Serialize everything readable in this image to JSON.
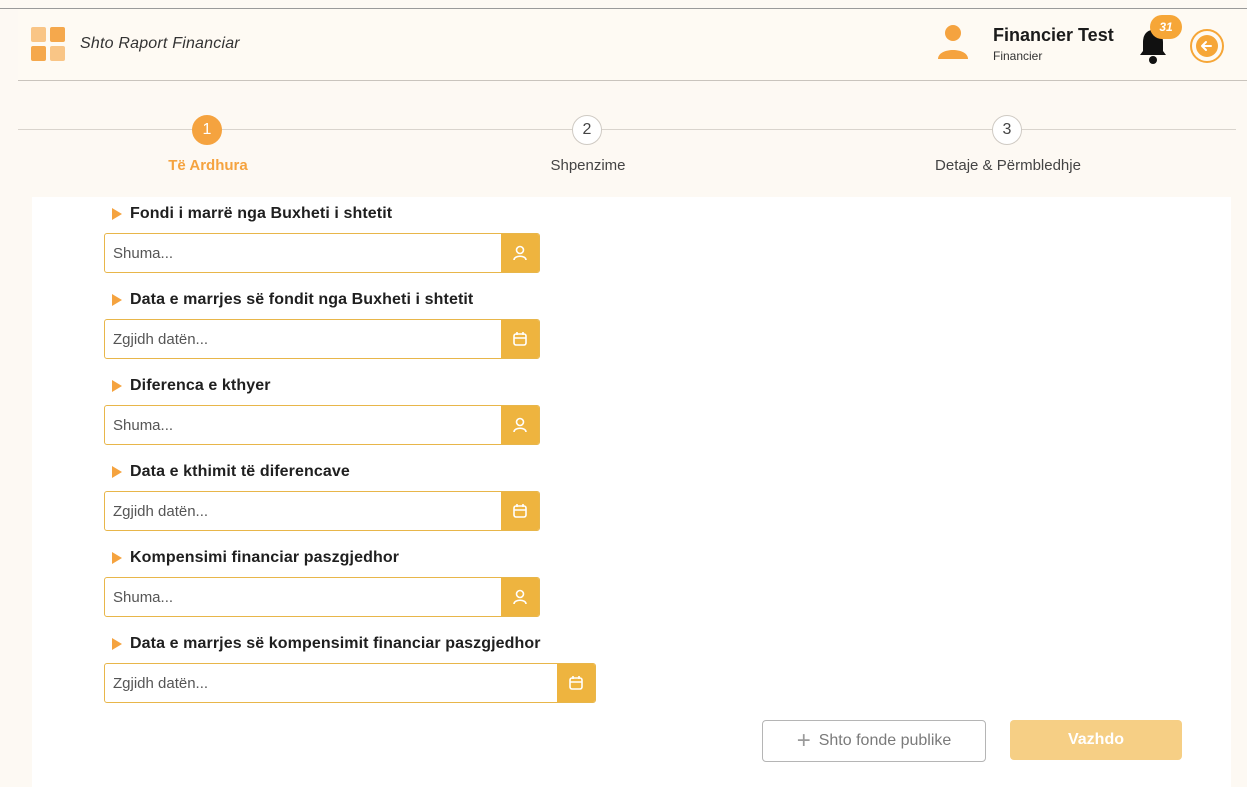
{
  "header": {
    "title": "Shto Raport Financiar",
    "user_name": "Financier Test",
    "user_role": "Financier",
    "notification_count": "31",
    "icons": {
      "logo": "grid-logo-icon",
      "user": "user-icon",
      "bell": "bell-icon",
      "logout": "logout-icon"
    }
  },
  "stepper": {
    "steps": [
      {
        "number": "1",
        "label": "Të Ardhura",
        "active": true
      },
      {
        "number": "2",
        "label": "Shpenzime",
        "active": false
      },
      {
        "number": "3",
        "label": "Detaje & Përmbledhje",
        "active": false
      }
    ]
  },
  "form": {
    "fields": [
      {
        "label": "Fondi i marrë nga Buxheti i shtetit",
        "placeholder": "Shuma...",
        "value": "",
        "icon": "user-icon"
      },
      {
        "label": "Data e marrjes së fondit nga Buxheti i shtetit",
        "placeholder": "Zgjidh datën...",
        "value": "",
        "icon": "calendar-icon"
      },
      {
        "label": "Diferenca e kthyer",
        "placeholder": "Shuma...",
        "value": "",
        "icon": "user-icon"
      },
      {
        "label": "Data e kthimit të diferencave",
        "placeholder": "Zgjidh datën...",
        "value": "",
        "icon": "calendar-icon"
      },
      {
        "label": "Kompensimi financiar paszgjedhor",
        "placeholder": "Shuma...",
        "value": "",
        "icon": "user-icon"
      },
      {
        "label": "Data e marrjes së kompensimit financiar paszgjedhor",
        "placeholder": "Zgjidh datën...",
        "value": "",
        "icon": "calendar-icon"
      }
    ]
  },
  "actions": {
    "add_label": "Shto fonde publike",
    "next_label": "Vazhdo"
  },
  "colors": {
    "accent": "#f5a33f",
    "addon": "#eeb43f",
    "next_disabled": "#f6cf85"
  }
}
